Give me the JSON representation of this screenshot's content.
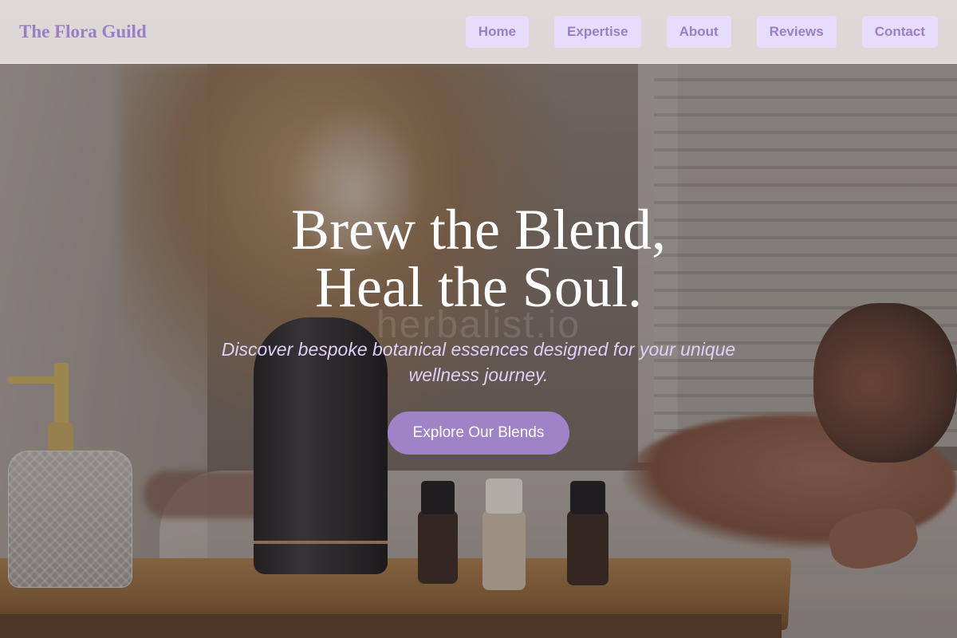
{
  "brand": {
    "name": "The Flora Guild",
    "color": "#9a7fc7"
  },
  "nav": {
    "items": [
      {
        "label": "Home"
      },
      {
        "label": "Expertise"
      },
      {
        "label": "About"
      },
      {
        "label": "Reviews"
      },
      {
        "label": "Contact"
      }
    ]
  },
  "hero": {
    "title_line1": "Brew the Blend,",
    "title_line2": "Heal the Soul.",
    "watermark": "herbalist.io",
    "subtitle": "Discover bespoke botanical essences designed for your unique wellness journey.",
    "cta_label": "Explore Our Blends",
    "cta_color": "#a082c6"
  }
}
